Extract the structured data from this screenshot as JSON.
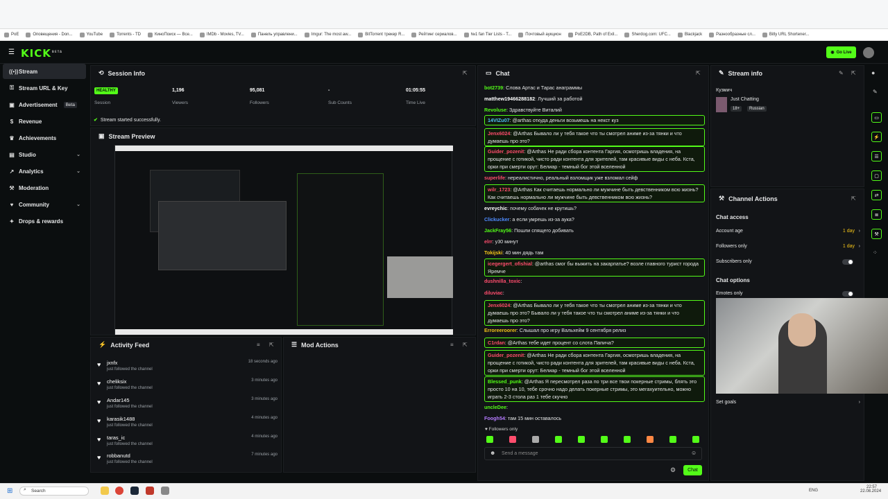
{
  "bookmarks": [
    "PoE",
    "Оповещения - Don...",
    "YouTube",
    "Torrents - TD",
    "КиноПоиск — Все...",
    "IMDb - Movies, TV...",
    "Панель управлени...",
    "Imgur: The most aw...",
    "BitTorrent трекер R...",
    "Рейтинг сериалов...",
    "№1 fan Tier Lists - T...",
    "Почтовый аукцион",
    "PoE2DB, Path of Exil...",
    "Sherdog.com: UFC...",
    "Blackjack",
    "Разнообразные сл...",
    "Bitly URL Shortener..."
  ],
  "header": {
    "logo": "KICK",
    "logo_badge": "BETA",
    "go_live": "Go Live"
  },
  "sidebar": {
    "items": [
      {
        "label": "Stream",
        "icon": "stream-icon"
      },
      {
        "label": "Stream URL & Key",
        "icon": "key-icon"
      },
      {
        "label": "Advertisement",
        "icon": "ad-icon",
        "badge": "Beta"
      },
      {
        "label": "Revenue",
        "icon": "dollar-icon"
      },
      {
        "label": "Achievements",
        "icon": "trophy-icon"
      },
      {
        "label": "Studio",
        "icon": "studio-icon"
      },
      {
        "label": "Analytics",
        "icon": "analytics-icon"
      },
      {
        "label": "Moderation",
        "icon": "hammer-icon"
      },
      {
        "label": "Community",
        "icon": "community-icon"
      },
      {
        "label": "Drops & rewards",
        "icon": "gift-icon"
      }
    ]
  },
  "session": {
    "title": "Session Info",
    "status": "HEALTHY",
    "stats": [
      {
        "value": "",
        "label": "Session"
      },
      {
        "value": "1,196",
        "label": "Viewers"
      },
      {
        "value": "95,081",
        "label": "Followers"
      },
      {
        "value": "-",
        "label": "Sub Counts"
      },
      {
        "value": "01:05:55",
        "label": "Time Live"
      }
    ],
    "success": "Stream started successfully."
  },
  "preview": {
    "title": "Stream Preview"
  },
  "activity": {
    "title": "Activity Feed",
    "items": [
      {
        "name": "jxnfx",
        "sub": "just followed the channel",
        "time": "18 seconds ago"
      },
      {
        "name": "cheliksix",
        "sub": "just followed the channel",
        "time": "3 minutes ago"
      },
      {
        "name": "Andar145",
        "sub": "just followed the channel",
        "time": "3 minutes ago"
      },
      {
        "name": "karasik1488",
        "sub": "just followed the channel",
        "time": "4 minutes ago"
      },
      {
        "name": "taras_ic",
        "sub": "just followed the channel",
        "time": "4 minutes ago"
      },
      {
        "name": "robbanutd",
        "sub": "just followed the channel",
        "time": "7 minutes ago"
      }
    ]
  },
  "mod_actions": {
    "title": "Mod Actions"
  },
  "chat": {
    "title": "Chat",
    "messages": [
      {
        "user": "bot2739",
        "color": "#53fc18",
        "text": "Слова Артас и Тарас анаграммы",
        "hl": false
      },
      {
        "user": "matthew19466288182",
        "color": "#ffffff",
        "text": "Лучший за работой",
        "hl": false
      },
      {
        "user": "Revoluse",
        "color": "#53fc18",
        "text": "Здравствуйте Виталий",
        "hl": false
      },
      {
        "user": "14VIZu07",
        "color": "#4fc3f7",
        "text": "@arthas откуда деньги возьмешь на некст куз",
        "hl": true
      },
      {
        "user": "Jenx6024",
        "color": "#ff4d6d",
        "text": "@Arthas Бывало ли у тебя такое что ты смотрел аниме из-за тянки и что думаешь про это?",
        "hl": true
      },
      {
        "user": "Guider_pozenit",
        "color": "#ff4d6d",
        "text": "@Arthas Не ради сбора контента Гаргия, осмотришь владения, на прощение с готикой, чисто ради контента для зрителей, там красивые виды с неба. Кста, орки при смерти орут: Белиар - темный бог этой вселенной",
        "hl": true
      },
      {
        "user": "superlife",
        "color": "#ff4d6d",
        "text": "нереалистично, реальный взломщик уже взломал сейф",
        "hl": false
      },
      {
        "user": "wilr_1723",
        "color": "#ff4d6d",
        "text": "@Arthas Как считаешь нормально ли мужчине быть девственником всю жизнь? Как считаешь нормально ли мужчине быть девственником всю жизнь?",
        "hl": true
      },
      {
        "user": "evreychic",
        "color": "#ffffff",
        "text": "почему собачек не крутишь?",
        "hl": false
      },
      {
        "user": "Clickucker",
        "color": "#4f8cff",
        "text": "а если умрешь из-за аука?",
        "hl": false
      },
      {
        "user": "JackFray56",
        "color": "#53fc18",
        "text": "Пошли спящего добивать",
        "hl": false
      },
      {
        "user": "elrr",
        "color": "#ff4d6d",
        "text": "у30 минут",
        "hl": false
      },
      {
        "user": "Tokijski",
        "color": "#f5c518",
        "text": "40 мин дядь там",
        "hl": false
      },
      {
        "user": "icegergert_ofishial",
        "color": "#ff4d6d",
        "text": "@arthas смог бы выжить на закарпатье? возле главного турист города Яремче",
        "hl": true
      },
      {
        "user": "dushnilla_toxic",
        "color": "#ff4d6d",
        "text": "",
        "hl": false
      },
      {
        "user": "diluviac",
        "color": "#ff4d6d",
        "text": "",
        "hl": false
      },
      {
        "user": "Jenx6024",
        "color": "#ff4d6d",
        "text": "@Arthas Бывало ли у тебя такое что ты смотрел аниме из-за тянки и что думаешь про это? Бывало ли у тебя такое что ты смотрел аниме из-за тянки и что думаешь про это?",
        "hl": true
      },
      {
        "user": "Erroreeroorer",
        "color": "#f5c518",
        "text": "Слышал про игру Вальхейм 9 сентября релиз",
        "hl": false
      },
      {
        "user": "C1rdan",
        "color": "#ff4d6d",
        "text": "@Arthas тебе идет процент со слота Папича?",
        "hl": true
      },
      {
        "user": "Guider_pozenit",
        "color": "#ff4d6d",
        "text": "@Arthas Не ради сбора контента Гаргия, осмотришь владения, на прощение с готикой, чисто ради контента для зрителей, там красивые виды с неба. Кста, орки при смерти орут: Белиар - темный бог этой вселенной",
        "hl": true
      },
      {
        "user": "Blessed_punk",
        "color": "#53fc18",
        "text": "@Arthas Я пересмотрел раза по три все твои покерные стримы, блять это просто 10 на 10, тебе срочно надо делать покерные стримы, это мегахуительно, можно играть 2-3 стола раз 1 тебе скучно",
        "hl": true
      },
      {
        "user": "uncleDee",
        "color": "#53fc18",
        "text": "",
        "hl": false
      },
      {
        "user": "Foogh54",
        "color": "#b57bff",
        "text": "там 15 мин оставалось",
        "hl": false
      }
    ],
    "followers_only": "Followers only",
    "placeholder": "Send a message",
    "send": "Chat"
  },
  "stream_info": {
    "title": "Stream info",
    "channel": "Кузмич",
    "category": "Just Chatting",
    "age": "18+",
    "language": "Russian"
  },
  "channel_actions": {
    "title": "Channel Actions",
    "chat_access": "Chat access",
    "account_age": {
      "label": "Account age",
      "value": "1 day"
    },
    "followers_only": {
      "label": "Followers only",
      "value": "1 day"
    },
    "subscribers_only": {
      "label": "Subscribers only"
    },
    "chat_options": "Chat options",
    "emotes_only": {
      "label": "Emotes only"
    },
    "set_goals": "Set goals"
  },
  "taskbar": {
    "search": "Search",
    "lang": "ENG",
    "time": "22:57",
    "date": "22.08.2024"
  },
  "colors": {
    "accent": "#53fc18",
    "bg": "#0b0e0f",
    "panel": "#121417"
  }
}
